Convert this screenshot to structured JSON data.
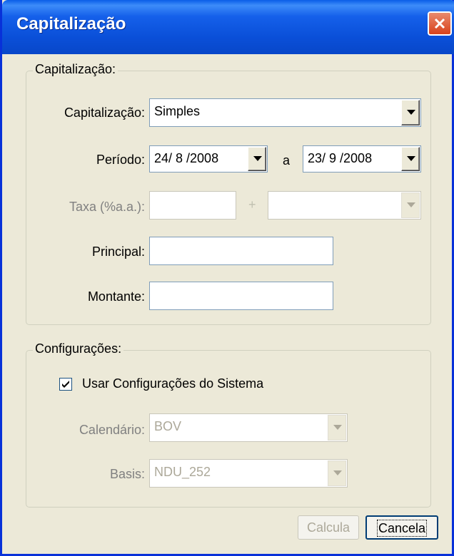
{
  "window": {
    "title": "Capitalização"
  },
  "group1": {
    "legend": "Capitalização:",
    "capitalizacao_label": "Capitalização:",
    "capitalizacao_value": "Simples",
    "periodo_label": "Período:",
    "periodo_start": "24/ 8 /2008",
    "periodo_sep": "a",
    "periodo_end": "23/ 9 /2008",
    "taxa_label": "Taxa (%a.a.):",
    "taxa_value": "",
    "taxa_plus": "+",
    "taxa_extra": "",
    "principal_label": "Principal:",
    "principal_value": "",
    "montante_label": "Montante:",
    "montante_value": ""
  },
  "group2": {
    "legend": "Configurações:",
    "use_system_label": "Usar Configurações do Sistema",
    "use_system_checked": true,
    "calendario_label": "Calendário:",
    "calendario_value": "BOV",
    "basis_label": "Basis:",
    "basis_value": "NDU_252"
  },
  "buttons": {
    "calcula": "Calcula",
    "cancela": "Cancela"
  },
  "colors": {
    "titlebar": "#0a4fd8",
    "face": "#ece9d8",
    "field_border": "#7f9db9"
  },
  "icons": {
    "close": "close-icon",
    "dropdown": "chevron-down-icon",
    "check": "check-icon"
  }
}
